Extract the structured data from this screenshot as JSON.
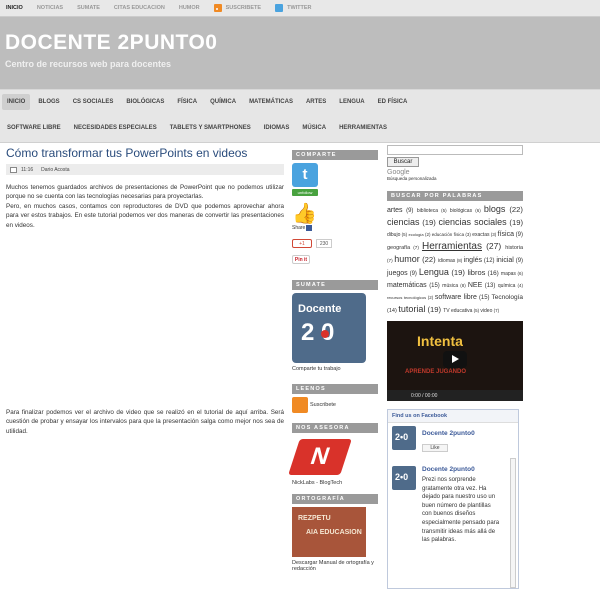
{
  "topnav": {
    "items": [
      "INICIO",
      "NOTICIAS",
      "SUMATE",
      "CITAS EDUCACION",
      "HUMOR"
    ],
    "suscribete": "SUSCRIBETE",
    "twitter": "TWITTER"
  },
  "header": {
    "title": "DOCENTE 2PUNTO0",
    "tagline": "Centro de recursos web para docentes"
  },
  "menu1": [
    "INICIO",
    "BLOGS",
    "CS SOCIALES",
    "BIOLÓGICAS",
    "FÍSICA",
    "QUÍMICA",
    "MATEMÁTICAS",
    "ARTES",
    "LENGUA",
    "ED FÍSICA"
  ],
  "menu2": [
    "SOFTWARE LIBRE",
    "NECESIDADES ESPECIALES",
    "TABLETS Y SMARTPHONES",
    "IDIOMAS",
    "MÚSICA",
    "HERRAMIENTAS"
  ],
  "post": {
    "title": "Cómo transformar tus PowerPoints en videos",
    "time": "11:16",
    "author": "Dario Acosta",
    "p1": "Muchos tenemos guardados archivos de presentaciones de PowerPoint que no podemos utilizar porque no se cuenta con las tecnologías necesarias para proyectarlas.",
    "p1b": "Pero, en muchos casos, contamos con reproductores de DVD que podemos aprovechar ahora para ver estos trabajos. En este tutorial podemos ver dos maneras de convertir las presentaciones en videos.",
    "p2": "Para finalizar podemos ver el archivo de video que se realizó en el tutorial de aquí arriba. Será cuestión de probar y ensayar los intervalos para que la presentación salga como mejor nos sea de utilidad."
  },
  "mid": {
    "comparte": "COMPARTE",
    "tw_small": "unfollow",
    "share": "Share",
    "gplus": "+1",
    "gcount": "230",
    "pinit": "Pin it",
    "sumate": "SUMATE",
    "logo_l1": "Docente",
    "logo_l2": "2 0",
    "comparte_trabajo": "Comparte tu trabajo",
    "leenos": "LEENOS",
    "suscribete": "Suscribete",
    "nos_asesora": "NOS ASESORA",
    "nicklabs": "NickLabs - BlogTech",
    "ortografia": "ORTOGRAFÍA",
    "orto_cap": "Descargar Manual de ortografía y redacción"
  },
  "right": {
    "search_button": "Buscar",
    "google": "Google",
    "google_cap": "Búsqueda personalizada",
    "tags_title": "BUSCAR POR PALABRAS",
    "tags": [
      {
        "t": "artes",
        "c": "(9)",
        "s": 7
      },
      {
        "t": "biblioteca",
        "c": "(5)",
        "s": 5
      },
      {
        "t": "biológicas",
        "c": "(6)",
        "s": 5
      },
      {
        "t": "blogs",
        "c": "(22)",
        "s": 9
      },
      {
        "t": "ciencias",
        "c": "(19)",
        "s": 9
      },
      {
        "t": "ciencias sociales",
        "c": "(19)",
        "s": 9
      },
      {
        "t": "dibujo",
        "c": "(5)",
        "s": 5
      },
      {
        "t": "ecología",
        "c": "(2)",
        "s": 4
      },
      {
        "t": "educación física",
        "c": "(3)",
        "s": 4.5
      },
      {
        "t": "exactas",
        "c": "(3)",
        "s": 5
      },
      {
        "t": "física",
        "c": "(9)",
        "s": 7
      },
      {
        "t": "geografía",
        "c": "(7)",
        "s": 5.5
      },
      {
        "t": "Herramientas",
        "c": "(27)",
        "s": 10
      },
      {
        "t": "historia",
        "c": "(7)",
        "s": 5.5
      },
      {
        "t": "humor",
        "c": "(22)",
        "s": 9
      },
      {
        "t": "idiomas",
        "c": "(8)",
        "s": 5
      },
      {
        "t": "inglés",
        "c": "(12)",
        "s": 7
      },
      {
        "t": "inicial",
        "c": "(9)",
        "s": 7
      },
      {
        "t": "juegos",
        "c": "(9)",
        "s": 7
      },
      {
        "t": "Lengua",
        "c": "(19)",
        "s": 9
      },
      {
        "t": "libros",
        "c": "(16)",
        "s": 7.5
      },
      {
        "t": "mapas",
        "c": "(6)",
        "s": 5
      },
      {
        "t": "matemáticas",
        "c": "(15)",
        "s": 7
      },
      {
        "t": "música",
        "c": "(8)",
        "s": 5
      },
      {
        "t": "NEE",
        "c": "(13)",
        "s": 7
      },
      {
        "t": "química",
        "c": "(4)",
        "s": 5
      },
      {
        "t": "recursos tecnológicos",
        "c": "(2)",
        "s": 4
      },
      {
        "t": "software libre",
        "c": "(15)",
        "s": 7
      },
      {
        "t": "Tecnología",
        "c": "(14)",
        "s": 6.5
      },
      {
        "t": "tutorial",
        "c": "(19)",
        "s": 9
      },
      {
        "t": "TV educativa",
        "c": "(5)",
        "s": 5
      },
      {
        "t": "video",
        "c": "(7)",
        "s": 5
      }
    ],
    "video_title": "Intenta",
    "video_text": "APRENDE JUGANDO",
    "video_time": "0:00 / 00:00",
    "fb_header": "Find us on Facebook",
    "fb_page": "Docente 2punto0",
    "fb_like": "Like",
    "fb_post": "Prezi nos sorprende gratamente otra vez. Ha dejado para nuestro uso un buen número de plantillas con buenos diseños especialmente pensado para transmitir ideas más allá de las palabras."
  }
}
